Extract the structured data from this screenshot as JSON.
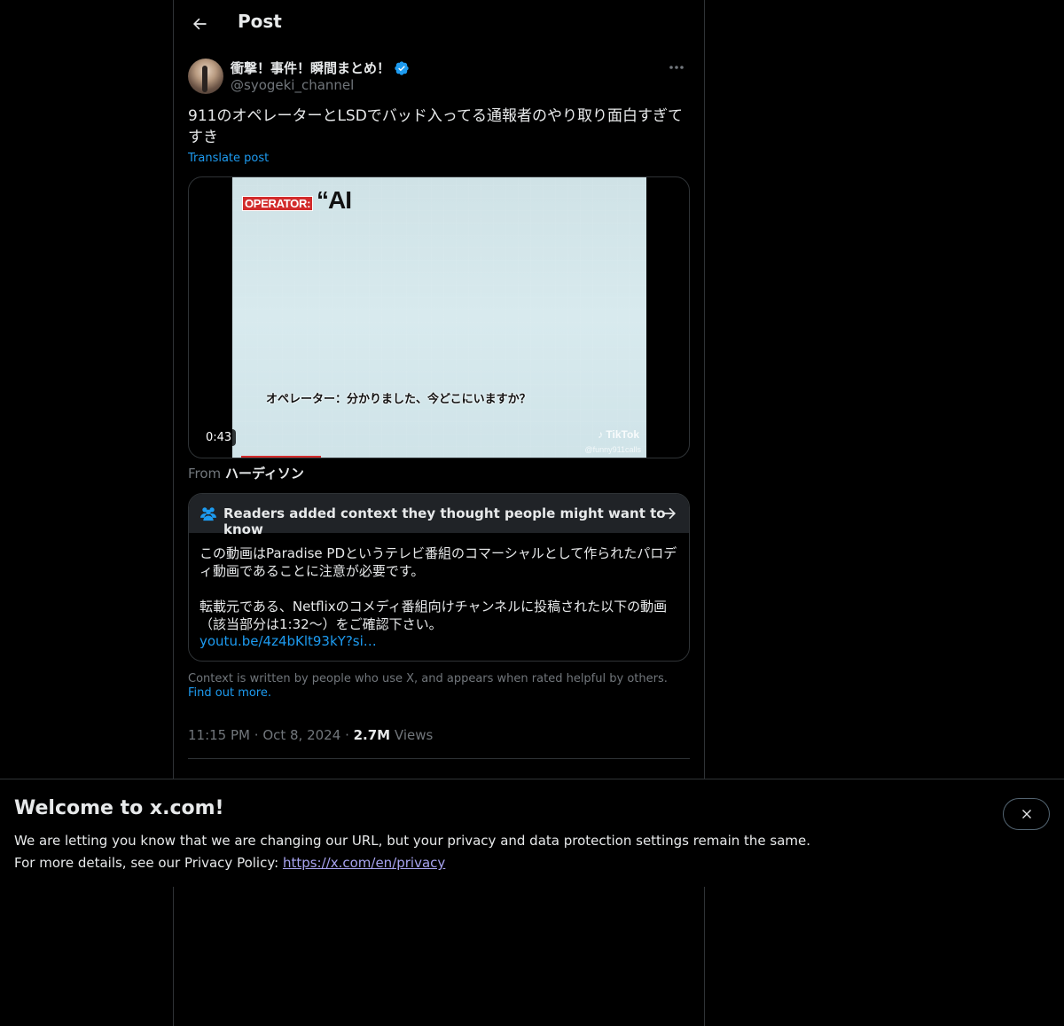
{
  "header": {
    "title": "Post"
  },
  "author": {
    "display_name": "衝撃！事件！瞬間まとめ！",
    "handle": "@syogeki_channel"
  },
  "post": {
    "text": "911のオペレーターとLSDでバッド入ってる通報者のやり取り面白すぎてすき",
    "translate_label": "Translate post"
  },
  "video": {
    "badge": "OPERATOR:",
    "quote": "“AI",
    "subtitle": "オペレーター：分かりました、今どこにいますか？",
    "tiktok": "♪ TikTok",
    "tiktok_handle": "@funny911calls",
    "duration": "0:43"
  },
  "source": {
    "prefix": "From",
    "name": "ハーディソン"
  },
  "community_note": {
    "title": "Readers added context they thought people might want to know",
    "paragraph1": "この動画はParadise PDというテレビ番組のコマーシャルとして作られたパロディ動画であることに注意が必要です。",
    "paragraph2": "転載元である、Netflixのコメディ番組向けチャンネルに投稿された以下の動画（該当部分は1:32〜）をご確認下さい。",
    "link": "youtu.be/4z4bKlt93kY?si…",
    "footer_text": "Context is written by people who use X, and appears when rated helpful by others.",
    "footer_link": "Find out more."
  },
  "meta": {
    "time": "11:15 PM",
    "date": "Oct 8, 2024",
    "views_count": "2.7M",
    "views_label": "Views"
  },
  "banner": {
    "title": "Welcome to x.com!",
    "line1": "We are letting you know that we are changing our URL, but your privacy and data protection settings remain the same.",
    "line2_prefix": "For more details, see our Privacy Policy: ",
    "privacy_link": "https://x.com/en/privacy"
  },
  "colors": {
    "accent": "#1d9bf0",
    "background": "#000000",
    "text": "#e7e9ea",
    "muted": "#71767b",
    "border": "#2f3336"
  },
  "icons": [
    "back-arrow-icon",
    "verified-badge-icon",
    "more-options-icon",
    "people-icon",
    "arrow-right-icon",
    "close-icon"
  ]
}
